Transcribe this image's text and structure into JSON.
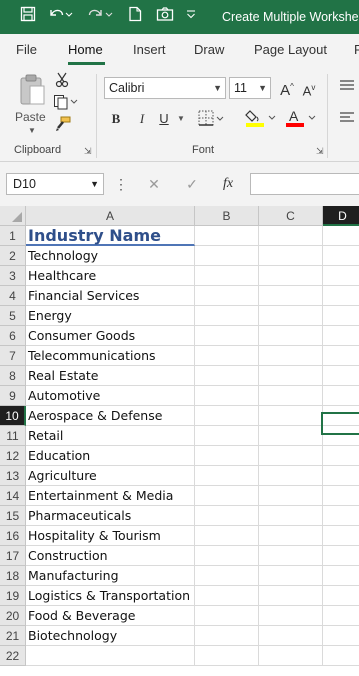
{
  "title_bar": {
    "title": "Create Multiple Workshee",
    "icons": [
      "save-icon",
      "undo-icon",
      "redo-icon",
      "new-file-icon",
      "camera-icon",
      "customize-qat-icon"
    ]
  },
  "ribbon_tabs": [
    "File",
    "Home",
    "Insert",
    "Draw",
    "Page Layout",
    "F"
  ],
  "active_tab": "Home",
  "clipboard": {
    "paste_label": "Paste",
    "group_label": "Clipboard"
  },
  "font_group": {
    "font_name": "Calibri",
    "font_size": "11",
    "bold": "B",
    "italic": "I",
    "underline": "U",
    "grow_font": "A",
    "shrink_font": "A",
    "font_color": "A",
    "group_label": "Font",
    "highlight_color": "#ffff00",
    "font_color_swatch": "#ff0000"
  },
  "formula_bar": {
    "name_box": "D10",
    "fx": "fx",
    "value": ""
  },
  "columns": [
    "A",
    "B",
    "C",
    "D"
  ],
  "selected_column": "D",
  "selected_row": 10,
  "rows": [
    {
      "num": "1",
      "a": "Industry Name"
    },
    {
      "num": "2",
      "a": "Technology"
    },
    {
      "num": "3",
      "a": "Healthcare"
    },
    {
      "num": "4",
      "a": "Financial Services"
    },
    {
      "num": "5",
      "a": "Energy"
    },
    {
      "num": "6",
      "a": "Consumer Goods"
    },
    {
      "num": "7",
      "a": "Telecommunications"
    },
    {
      "num": "8",
      "a": "Real Estate"
    },
    {
      "num": "9",
      "a": "Automotive"
    },
    {
      "num": "10",
      "a": "Aerospace & Defense"
    },
    {
      "num": "11",
      "a": "Retail"
    },
    {
      "num": "12",
      "a": "Education"
    },
    {
      "num": "13",
      "a": "Agriculture"
    },
    {
      "num": "14",
      "a": "Entertainment & Media"
    },
    {
      "num": "15",
      "a": "Pharmaceuticals"
    },
    {
      "num": "16",
      "a": "Hospitality & Tourism"
    },
    {
      "num": "17",
      "a": "Construction"
    },
    {
      "num": "18",
      "a": "Manufacturing"
    },
    {
      "num": "19",
      "a": "Logistics & Transportation"
    },
    {
      "num": "20",
      "a": "Food & Beverage"
    },
    {
      "num": "21",
      "a": "Biotechnology"
    },
    {
      "num": "22",
      "a": ""
    }
  ],
  "colors": {
    "excel_green": "#217346",
    "header_text": "#2f4f8a"
  }
}
